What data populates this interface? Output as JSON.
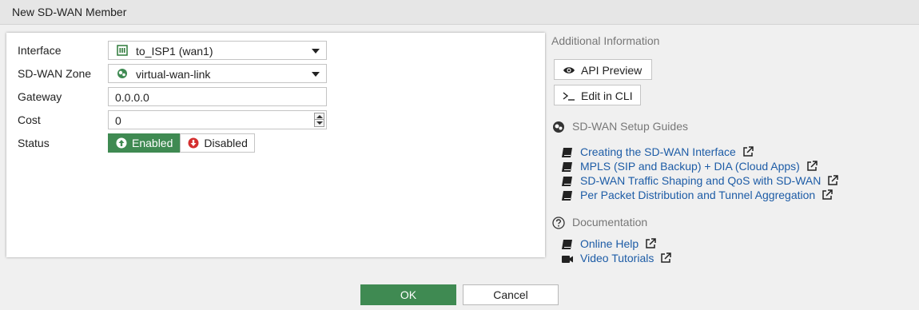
{
  "dialog": {
    "title": "New SD-WAN Member"
  },
  "form": {
    "interface": {
      "label": "Interface",
      "value": "to_ISP1 (wan1)",
      "icon": "port-icon"
    },
    "zone": {
      "label": "SD-WAN Zone",
      "value": "virtual-wan-link",
      "icon": "sdwan-zone-icon"
    },
    "gateway": {
      "label": "Gateway",
      "value": "0.0.0.0"
    },
    "cost": {
      "label": "Cost",
      "value": "0"
    },
    "status": {
      "label": "Status",
      "enabled_label": "Enabled",
      "disabled_label": "Disabled",
      "selected": "Enabled"
    }
  },
  "sidebar": {
    "additional_info_title": "Additional Information",
    "api_preview_label": "API Preview",
    "edit_cli_label": "Edit in CLI",
    "guides_title": "SD-WAN Setup Guides",
    "guides": [
      {
        "label": "Creating the SD-WAN Interface"
      },
      {
        "label": "MPLS (SIP and Backup) + DIA (Cloud Apps)"
      },
      {
        "label": "SD-WAN Traffic Shaping and QoS with SD-WAN"
      },
      {
        "label": "Per Packet Distribution and Tunnel Aggregation"
      }
    ],
    "docs_title": "Documentation",
    "online_help_label": "Online Help",
    "video_tutorials_label": "Video Tutorials"
  },
  "footer": {
    "ok_label": "OK",
    "cancel_label": "Cancel"
  },
  "colors": {
    "accent_green": "#3f8a52",
    "link_blue": "#1d5ca6",
    "disabled_red": "#d42e2e"
  }
}
